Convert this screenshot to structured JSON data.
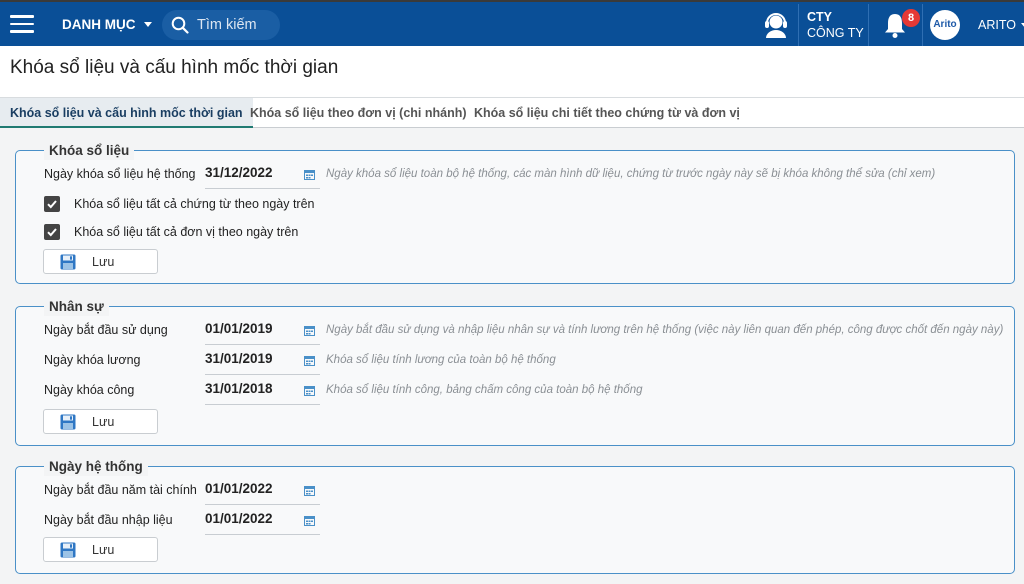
{
  "topbar": {
    "menu_label": "DANH MỤC",
    "search_placeholder": "Tìm kiếm",
    "company_code": "CTY",
    "company_name": "CÔNG TY",
    "notification_count": "8",
    "avatar_text": "Arito",
    "user_name": "ARITO",
    "colors": {
      "bar": "#0a4f97",
      "badge": "#e53935"
    }
  },
  "header": {
    "title": "Khóa sổ liệu và cấu hình mốc thời gian"
  },
  "tabs": [
    {
      "label": "Khóa sổ liệu và cấu hình mốc thời gian",
      "active": true
    },
    {
      "label": "Khóa sổ liệu theo đơn vị (chi nhánh)",
      "active": false
    },
    {
      "label": "Khóa sổ liệu chi tiết theo chứng từ và đơn vị",
      "active": false
    }
  ],
  "sections": {
    "lock": {
      "title": "Khóa sổ liệu",
      "rows": [
        {
          "label": "Ngày khóa sổ liệu hệ thống",
          "value": "31/12/2022",
          "note": "Ngày khóa sổ liệu toàn bộ hệ thống, các màn hình dữ liệu, chứng từ trước ngày này sẽ bị khóa không thể sửa (chỉ xem)"
        }
      ],
      "checkboxes": [
        {
          "label": "Khóa sổ liệu tất cả chứng từ theo ngày trên",
          "checked": true
        },
        {
          "label": "Khóa sổ liệu tất cả đơn vị theo ngày trên",
          "checked": true
        }
      ],
      "save_label": "Lưu"
    },
    "hr": {
      "title": "Nhân sự",
      "rows": [
        {
          "label": "Ngày bắt đầu sử dụng",
          "value": "01/01/2019",
          "note": "Ngày bắt đầu sử dụng và nhập liệu nhân sự và tính lương trên hệ thống (việc này liên quan đến phép, công được chốt đến ngày này)"
        },
        {
          "label": "Ngày khóa lương",
          "value": "31/01/2019",
          "note": "Khóa sổ liệu tính lương của toàn bộ hệ thống"
        },
        {
          "label": "Ngày khóa công",
          "value": "31/01/2018",
          "note": "Khóa sổ liệu tính công, bảng chấm công của toàn bộ hệ thống"
        }
      ],
      "save_label": "Lưu"
    },
    "system": {
      "title": "Ngày hệ thống",
      "rows": [
        {
          "label": "Ngày bắt đầu năm tài chính",
          "value": "01/01/2022"
        },
        {
          "label": "Ngày bắt đầu nhập liệu",
          "value": "01/01/2022"
        }
      ],
      "save_label": "Lưu"
    }
  }
}
